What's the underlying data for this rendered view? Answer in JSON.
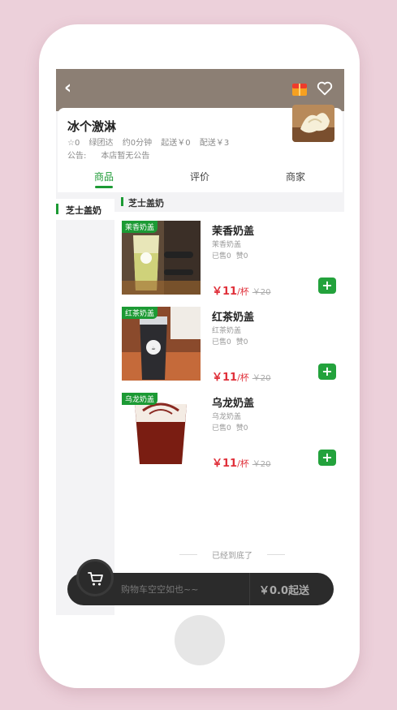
{
  "shop": {
    "name": "冰个激淋",
    "rating": "☆0",
    "delivery_by": "绿团达",
    "eta": "约0分钟",
    "min_order": "起送￥0",
    "delivery_fee": "配送￥3",
    "notice_label": "公告:",
    "notice_value": "本店暂无公告"
  },
  "tabs": [
    {
      "label": "商品",
      "active": true
    },
    {
      "label": "评价",
      "active": false
    },
    {
      "label": "商家",
      "active": false
    }
  ],
  "sidebar": {
    "items": [
      {
        "label": "芝士盖奶",
        "active": true
      }
    ]
  },
  "category": {
    "title": "芝士盖奶"
  },
  "products": [
    {
      "name": "茉香奶盖",
      "badge": "茉香奶盖",
      "desc": "茉香奶盖",
      "sold": "已售0",
      "likes": "赞0",
      "price": "￥11",
      "unit": "/杯",
      "old_price": "￥20"
    },
    {
      "name": "红茶奶盖",
      "badge": "红茶奶盖",
      "desc": "红茶奶盖",
      "sold": "已售0",
      "likes": "赞0",
      "price": "￥11",
      "unit": "/杯",
      "old_price": "￥20"
    },
    {
      "name": "乌龙奶盖",
      "badge": "乌龙奶盖",
      "desc": "乌龙奶盖",
      "sold": "已售0",
      "likes": "赞0",
      "price": "￥11",
      "unit": "/杯",
      "old_price": "￥20"
    }
  ],
  "list_end": "已经到底了",
  "cart": {
    "empty_text": "购物车空空如也~~",
    "checkout": "￥0.0起送"
  },
  "icons": {
    "back": "chevron-left-icon",
    "gift": "gift-icon",
    "favorite": "heart-icon",
    "add": "plus-icon",
    "cart": "cart-icon"
  },
  "colors": {
    "accent": "#1c9a34",
    "price": "#e0303a",
    "header": "#8c7f74",
    "background": "#ecd0da"
  }
}
